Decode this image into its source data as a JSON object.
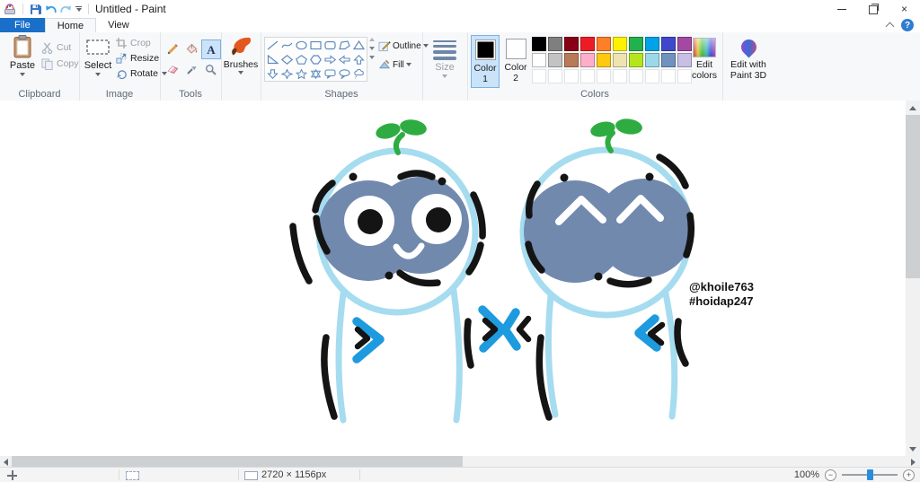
{
  "titlebar": {
    "title": "Untitled - Paint"
  },
  "window": {
    "close_glyph": "×",
    "help_glyph": "?"
  },
  "tabs": {
    "file": "File",
    "home": "Home",
    "view": "View"
  },
  "ribbon": {
    "clipboard": {
      "label": "Clipboard",
      "paste": "Paste",
      "cut": "Cut",
      "copy": "Copy"
    },
    "image": {
      "label": "Image",
      "select": "Select",
      "crop": "Crop",
      "resize": "Resize",
      "rotate": "Rotate"
    },
    "tools": {
      "label": "Tools",
      "text_glyph": "A",
      "brushes": "Brushes",
      "tool_icons": [
        "pencil",
        "fill",
        "text",
        "eraser",
        "color-picker",
        "magnifier"
      ]
    },
    "shapes": {
      "label": "Shapes",
      "outline": "Outline",
      "fill": "Fill",
      "shape_icons": [
        "line",
        "curve",
        "ellipse",
        "rectangle",
        "rounded-rectangle",
        "polygon",
        "triangle",
        "right-triangle",
        "diamond",
        "pentagon",
        "hexagon",
        "right-arrow",
        "left-arrow",
        "up-arrow",
        "down-arrow",
        "four-point-star",
        "five-point-star",
        "six-point-star",
        "rounded-callout",
        "oval-callout",
        "cloud-callout"
      ]
    },
    "size_label": "Size",
    "colors": {
      "label": "Colors",
      "color1": "Color 1",
      "color2": "Color 2",
      "edit": "Edit colors",
      "color1_value": "#000000",
      "color2_value": "#FFFFFF",
      "row1": [
        "#000000",
        "#7F7F7F",
        "#880015",
        "#ED1C24",
        "#FF7F27",
        "#FFF200",
        "#22B14C",
        "#00A2E8",
        "#3F48CC",
        "#A349A4"
      ],
      "row2": [
        "#FFFFFF",
        "#C3C3C3",
        "#B97A57",
        "#FFAEC9",
        "#FFC90E",
        "#EFE4B0",
        "#B5E61D",
        "#99D9EA",
        "#7092BE",
        "#C8BFE7"
      ],
      "empty_count": 10
    },
    "paint3d_label": "Edit with Paint 3D"
  },
  "canvas": {
    "handle": "@khoile763",
    "tag": "#hoidap247",
    "colors": {
      "outline": "#A6DCEF",
      "body": "#7289AE",
      "chevron": "#1E9BDF",
      "sprout": "#2FAC41",
      "ink": "#141414"
    }
  },
  "statusbar": {
    "canvas_size": "2720 × 1156px",
    "zoom": "100%",
    "zoom_out": "−",
    "zoom_in": "+"
  },
  "theme": {
    "file_tab": "#1a70c8",
    "help": "#2d7dd2",
    "selected_bg": "#cbe3f9",
    "selected_border": "#7ab0e2",
    "slider_thumb": "#2a8ddc"
  }
}
